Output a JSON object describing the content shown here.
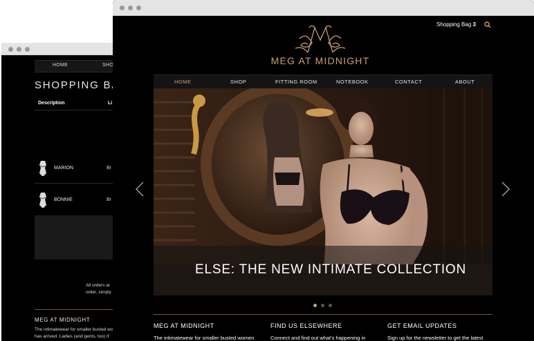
{
  "back_window": {
    "nav": [
      "HOME",
      "SHO"
    ],
    "title": "SHOPPING BAG",
    "columns": [
      "Description",
      "Li"
    ],
    "rows": [
      {
        "name": "MARION",
        "extra": "Br"
      },
      {
        "name": "BONNIE",
        "extra": "Br"
      }
    ],
    "notice": [
      "All orders ar",
      "order, simply"
    ],
    "footer_title": "MEG AT MIDNIGHT",
    "footer_text": [
      "The intimatewear for smaller busted wo",
      "has arrived. Ladies (and gents, too) it'"
    ]
  },
  "front_window": {
    "shopping_bag_label": "Shopping Bag",
    "shopping_bag_count": "3",
    "brand": "MEG AT MIDNIGHT",
    "nav": [
      {
        "label": "HOME",
        "active": true
      },
      {
        "label": "SHOP",
        "active": false
      },
      {
        "label": "FITTING ROOM",
        "active": false
      },
      {
        "label": "NOTEBOOK",
        "active": false
      },
      {
        "label": "CONTACT",
        "active": false
      },
      {
        "label": "ABOUT",
        "active": false
      }
    ],
    "hero_caption": "ELSE: THE NEW INTIMATE COLLECTION",
    "slider_pages": 3,
    "slider_active": 1,
    "footer": [
      {
        "title": "MEG AT MIDNIGHT",
        "text": "The intimatewear for smaller busted women"
      },
      {
        "title": "FIND US ELSEWHERE",
        "text": "Connect and find out what's happening in"
      },
      {
        "title": "GET EMAIL UPDATES",
        "text": "Sign up for the newsletter to get the latest"
      }
    ]
  },
  "colors": {
    "accent": "#c9a06d",
    "background": "#000000",
    "titlebar": "#e4e4e4"
  },
  "icons": [
    "search-icon",
    "arrow-left-icon",
    "arrow-right-icon",
    "logo-icon"
  ]
}
